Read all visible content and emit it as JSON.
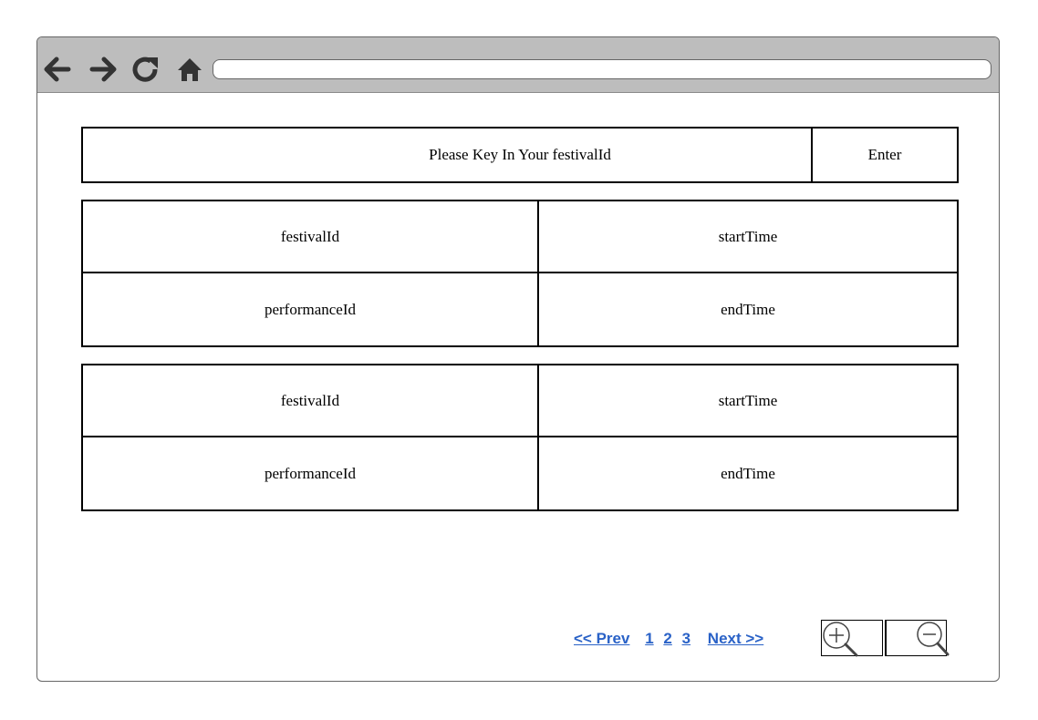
{
  "browser": {
    "address_value": "",
    "icons": {
      "back": "arrow-left-icon",
      "forward": "arrow-right-icon",
      "reload": "reload-icon",
      "home": "home-icon"
    }
  },
  "search": {
    "prompt": "Please Key In Your festivalId",
    "enter_label": "Enter"
  },
  "records": [
    {
      "festivalId_label": "festivalId",
      "startTime_label": "startTime",
      "performanceId_label": "performanceId",
      "endTime_label": "endTime"
    },
    {
      "festivalId_label": "festivalId",
      "startTime_label": "startTime",
      "performanceId_label": "performanceId",
      "endTime_label": "endTime"
    }
  ],
  "pagination": {
    "prev": "<< Prev",
    "pages": [
      "1",
      "2",
      "3"
    ],
    "next": "Next >>"
  },
  "zoom": {
    "in_icon": "zoom-in-icon",
    "out_icon": "zoom-out-icon"
  },
  "colors": {
    "toolbar": "#bdbdbd",
    "link": "#2a62c7",
    "icon": "#333333"
  }
}
